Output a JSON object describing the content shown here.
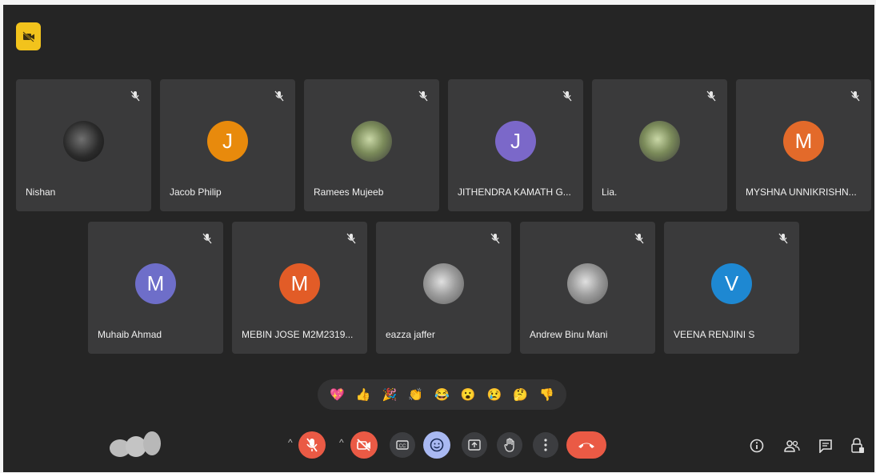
{
  "participants": [
    {
      "name": "Nishan",
      "avatar": "photo",
      "initial": "",
      "color": ""
    },
    {
      "name": "Jacob Philip",
      "avatar": "letter",
      "initial": "J",
      "color": "#e88a0c"
    },
    {
      "name": "Ramees Mujeeb",
      "avatar": "photo",
      "initial": "",
      "color": ""
    },
    {
      "name": "JITHENDRA KAMATH G...",
      "avatar": "letter",
      "initial": "J",
      "color": "#7b68c9"
    },
    {
      "name": "Lia.",
      "avatar": "photo",
      "initial": "",
      "color": ""
    },
    {
      "name": "MYSHNA UNNIKRISHN...",
      "avatar": "letter",
      "initial": "M",
      "color": "#e36a2a"
    },
    {
      "name": "Muhaib Ahmad",
      "avatar": "letter",
      "initial": "M",
      "color": "#6e6ec9"
    },
    {
      "name": "MEBIN JOSE M2M2319...",
      "avatar": "letter",
      "initial": "M",
      "color": "#e25c27"
    },
    {
      "name": "eazza jaffer",
      "avatar": "photo",
      "initial": "",
      "color": ""
    },
    {
      "name": "Andrew Binu Mani",
      "avatar": "photo",
      "initial": "",
      "color": ""
    },
    {
      "name": "VEENA RENJINI S",
      "avatar": "letter",
      "initial": "V",
      "color": "#1e88d2"
    }
  ],
  "reactions": [
    "💖",
    "👍",
    "🎉",
    "👏",
    "😂",
    "😮",
    "😢",
    "🤔",
    "👎"
  ],
  "colors": {
    "hangup": "#ea5a45",
    "mic_off": "#ea5a45",
    "cam_off": "#ea5a45",
    "reactions_active": "#a9b9f2",
    "badge": "#f2c31c"
  }
}
